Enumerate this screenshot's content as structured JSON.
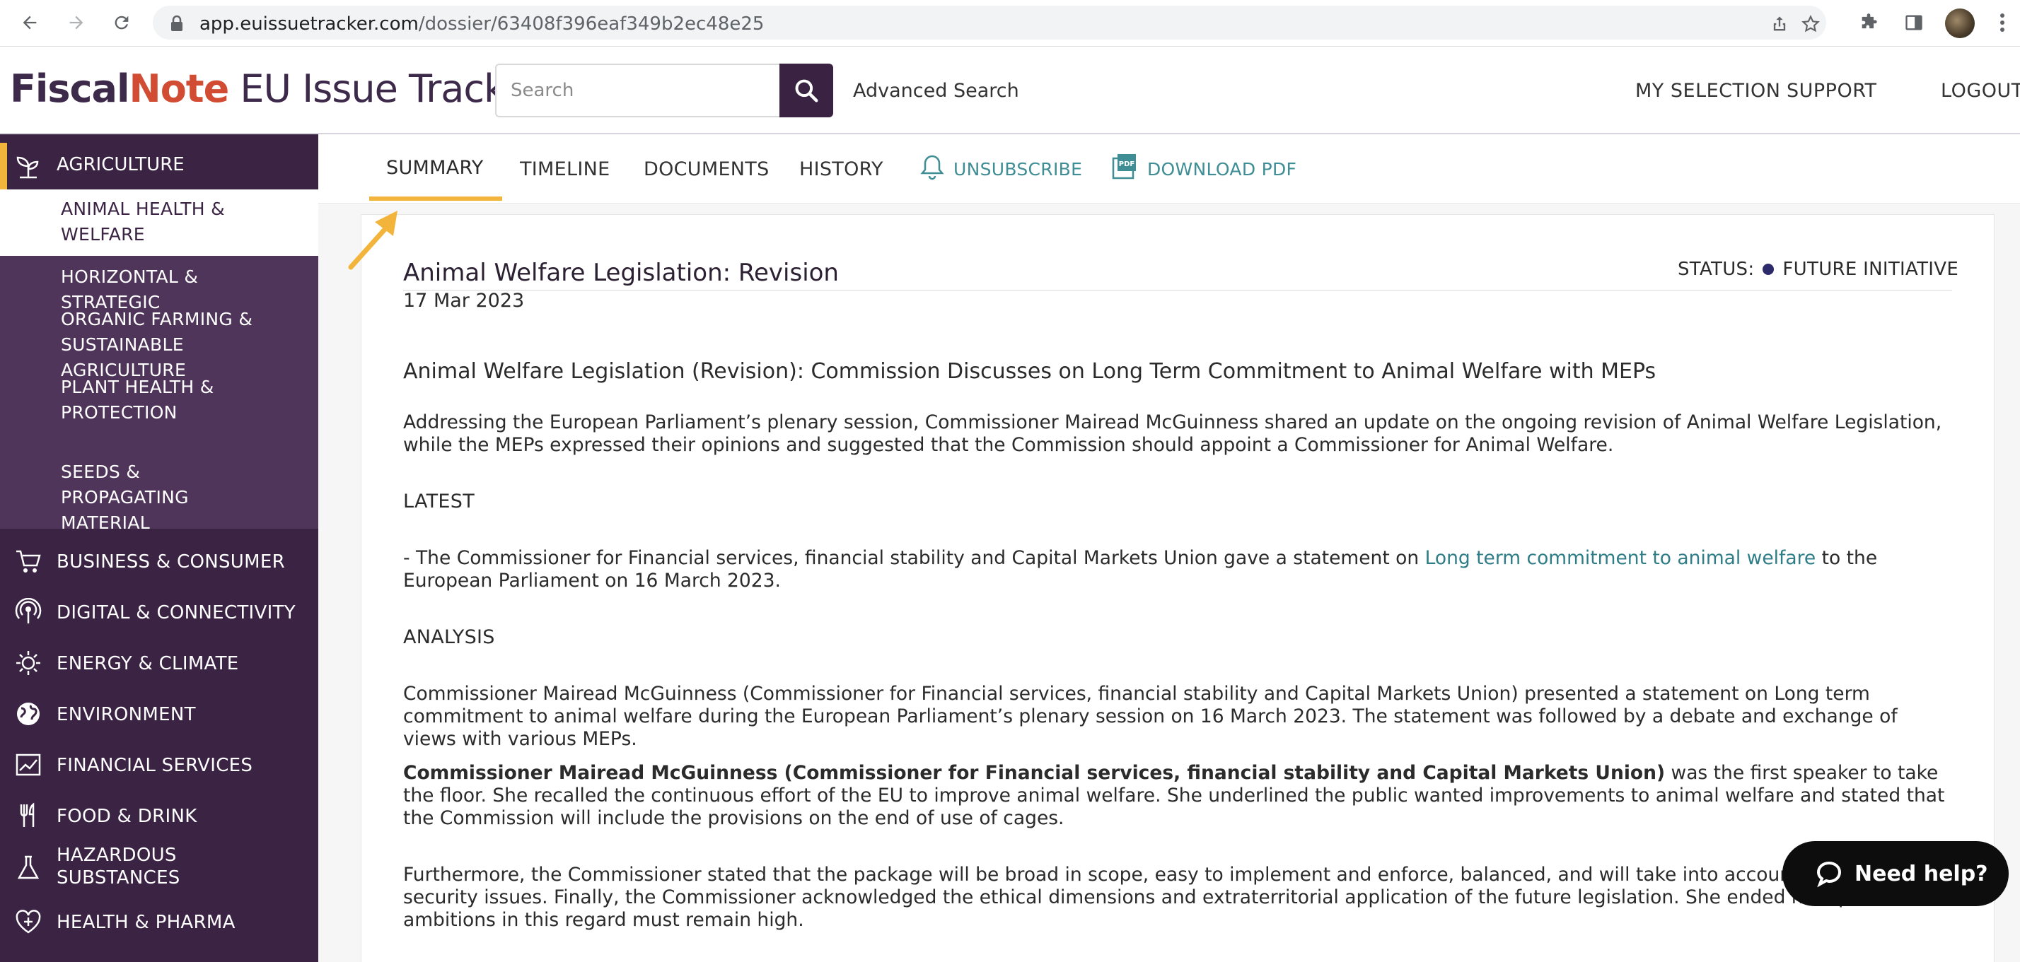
{
  "browser": {
    "url_host": "app.euissuetracker.com",
    "url_path": "/dossier/63408f396eaf349b2ec48e25"
  },
  "header": {
    "logo_fiscal": "Fiscal",
    "logo_note": "Note",
    "logo_suffix": " EU Issue Tracker",
    "search_placeholder": "Search",
    "advanced_search": "Advanced Search",
    "links": [
      "MY SELECTION",
      "SUPPORT",
      "LOGOUT"
    ]
  },
  "sidebar": {
    "active": "AGRICULTURE",
    "sub_items": [
      "ANIMAL HEALTH & WELFARE",
      "HORIZONTAL & STRATEGIC",
      "ORGANIC FARMING & SUSTAINABLE AGRICULTURE",
      "PLANT HEALTH & PROTECTION",
      "SEEDS & PROPAGATING MATERIAL"
    ],
    "items": [
      "BUSINESS & CONSUMER",
      "DIGITAL & CONNECTIVITY",
      "ENERGY & CLIMATE",
      "ENVIRONMENT",
      "FINANCIAL SERVICES",
      "FOOD & DRINK",
      "HAZARDOUS SUBSTANCES",
      "HEALTH & PHARMA"
    ]
  },
  "tabs": {
    "summary": "SUMMARY",
    "timeline": "TIMELINE",
    "documents": "DOCUMENTS",
    "history": "HISTORY",
    "unsubscribe": "UNSUBSCRIBE",
    "download_pdf": "DOWNLOAD PDF"
  },
  "dossier": {
    "title": "Animal Welfare Legislation: Revision",
    "date": "17 Mar 2023",
    "status_label": "STATUS:",
    "status_value": "FUTURE INITIATIVE",
    "headline": "Animal Welfare Legislation (Revision): Commission Discusses on Long Term Commitment to Animal Welfare with MEPs",
    "intro": "Addressing the European Parliament’s plenary session, Commissioner Mairead McGuinness shared an update on the ongoing revision of Animal Welfare Legislation, while the MEPs expressed their opinions and suggested that the Commission should appoint a Commissioner for Animal Welfare.",
    "latest_heading": "LATEST",
    "latest_pre": "- The Commissioner for Financial services, financial stability and Capital Markets Union gave a statement on ",
    "latest_link": "Long term commitment to animal welfare",
    "latest_post": " to the European Parliament on 16 March 2023.",
    "analysis_heading": "ANALYSIS",
    "analysis_p1": "Commissioner Mairead McGuinness (Commissioner for Financial services, financial stability and Capital Markets Union) presented a statement on Long term commitment to animal welfare during the European Parliament’s plenary session on 16 March 2023. The statement was followed by a debate and exchange of views with various MEPs.",
    "analysis_p2_bold": "Commissioner Mairead McGuinness (Commissioner for Financial services, financial stability and Capital Markets Union)",
    "analysis_p2_rest": " was the first speaker to take the floor. She recalled the continuous effort of the EU to improve animal welfare. She underlined the public wanted improvements to animal welfare and stated that the Commission will include the provisions on the end of use of cages.",
    "analysis_p3": "Furthermore, the Commissioner stated that the package will be broad in scope, easy to implement and enforce, balanced, and will take into account social, ec security issues. Finally, the Commissioner acknowledged the ethical dimensions and extraterritorial application of the future legislation. She ended her speech ambitions in this regard must remain high."
  },
  "help": {
    "label": "Need help?"
  },
  "colors": {
    "brand_purple": "#3b2344",
    "accent_yellow": "#f3b43b",
    "link_teal": "#2f7d86",
    "logo_red": "#d24c33"
  }
}
